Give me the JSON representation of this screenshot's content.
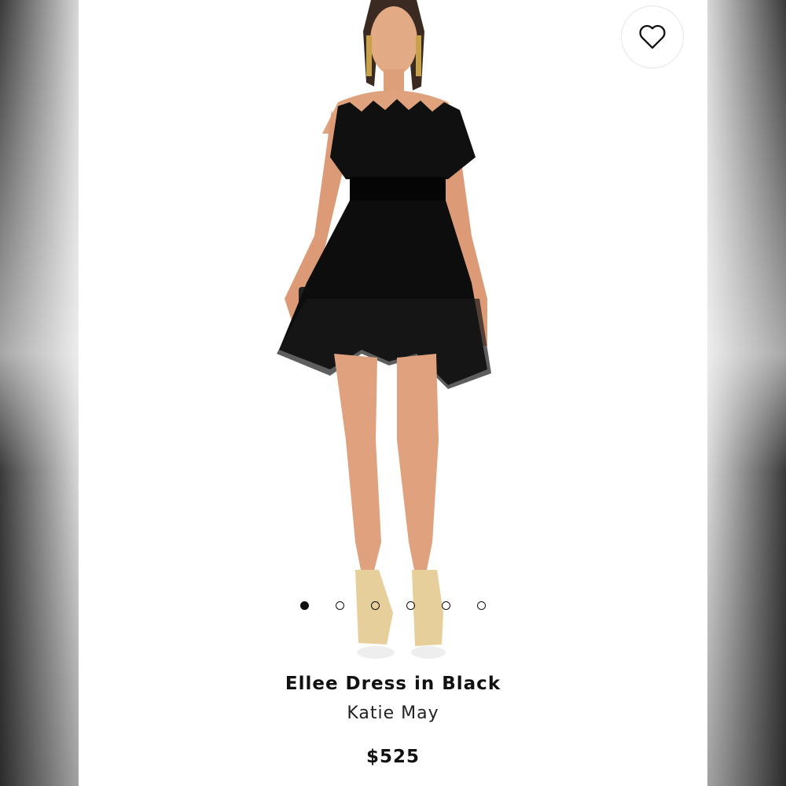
{
  "icons": {
    "favorite": "heart-outline-icon",
    "carousel_active": "filled-dot",
    "carousel_inactive": "hollow-dot"
  },
  "colors": {
    "text": "#111111",
    "dress": "#0d0d0d",
    "skin": "#e0a27e",
    "background": "#ffffff"
  },
  "carousel": {
    "total": 6,
    "active_index": 0
  },
  "product": {
    "title": "Ellee Dress in Black",
    "brand": "Katie May",
    "price": "$525"
  }
}
